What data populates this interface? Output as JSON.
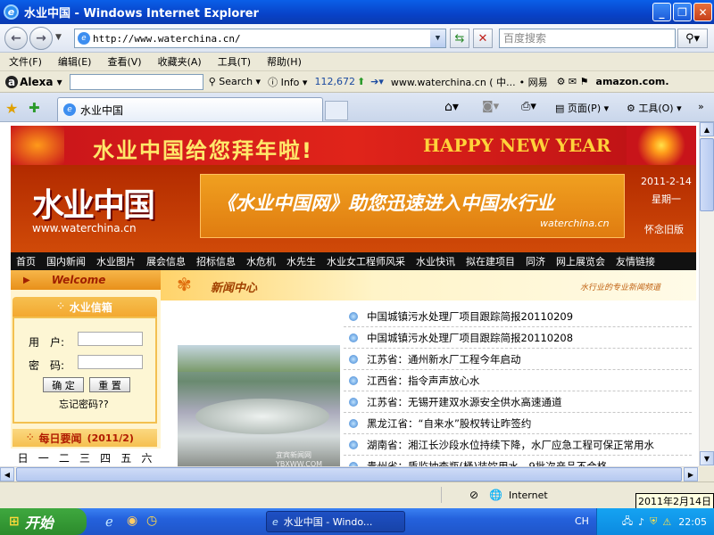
{
  "window": {
    "title": "水业中国 - Windows Internet Explorer"
  },
  "address": {
    "url": "http://www.waterchina.cn/",
    "search_placeholder": "百度搜索"
  },
  "menu": [
    "文件(F)",
    "编辑(E)",
    "查看(V)",
    "收藏夹(A)",
    "工具(T)",
    "帮助(H)"
  ],
  "alexa": {
    "label": "Alexa",
    "search": "Search",
    "info": "Info",
    "rank": "112,672",
    "site": "www.waterchina.cn ( 中...",
    "site2": "• 网易",
    "amazon": "amazon.com."
  },
  "tab": {
    "label": "水业中国"
  },
  "toolbar": {
    "page": "页面(P)",
    "tools": "工具(O)"
  },
  "page": {
    "banner_cn": "水业中国给您拜年啦!",
    "banner_en": "HAPPY NEW YEAR",
    "logo": "水业中国",
    "logo_url": "www.waterchina.cn",
    "slogan": "《水业中国网》助您迅速进入中国水行业",
    "slogan_url": "waterchina.cn",
    "date": "2011-2-14",
    "weekday": "星期一",
    "old_version": "怀念旧版",
    "nav": [
      "首页",
      "国内新闻",
      "水业图片",
      "展会信息",
      "招标信息",
      "水危机",
      "水先生",
      "水业女工程师风采",
      "水业快讯",
      "拟在建项目",
      "同济",
      "网上展览会",
      "友情链接"
    ],
    "welcome": "Welcome",
    "news_center": "新闻中心",
    "news_slogan": "水行业的专业新闻频道",
    "login_title": "水业信箱",
    "user_label": "用　户:",
    "pass_label": "密　码:",
    "confirm": "确 定",
    "reset": "重 置",
    "forgot": "忘记密码??",
    "daily_title": "每日要闻",
    "daily_month": "(2011/2)",
    "weekdays": [
      "日",
      "一",
      "二",
      "三",
      "四",
      "五",
      "六"
    ],
    "news": [
      "中国城镇污水处理厂项目跟踪简报20110209",
      "中国城镇污水处理厂项目跟踪简报20110208",
      "江苏省：通州新水厂工程今年启动",
      "江西省：指令声声放心水",
      "江苏省：无锡开建双水源安全供水高速通道",
      "黑龙江省：“自来水”股权转让昨签约",
      "湖南省：湘江长沙段水位持续下降，水厂应急工程可保正常用水",
      "贵州省：质监抽查瓶(桶)装饮用水，9批次产品不合格"
    ],
    "photo_watermark": "宜宾新闻网 YBXWW.COM"
  },
  "status": {
    "zone": "Internet",
    "date_tooltip": "2011年2月14日"
  },
  "taskbar": {
    "start": "开始",
    "window": "水业中国 - Windo...",
    "lang": "CH",
    "time": "22:05"
  },
  "colors": {
    "xp_blue": "#0842c8",
    "banner_red": "#d01c18",
    "gold": "#ffe24a"
  }
}
